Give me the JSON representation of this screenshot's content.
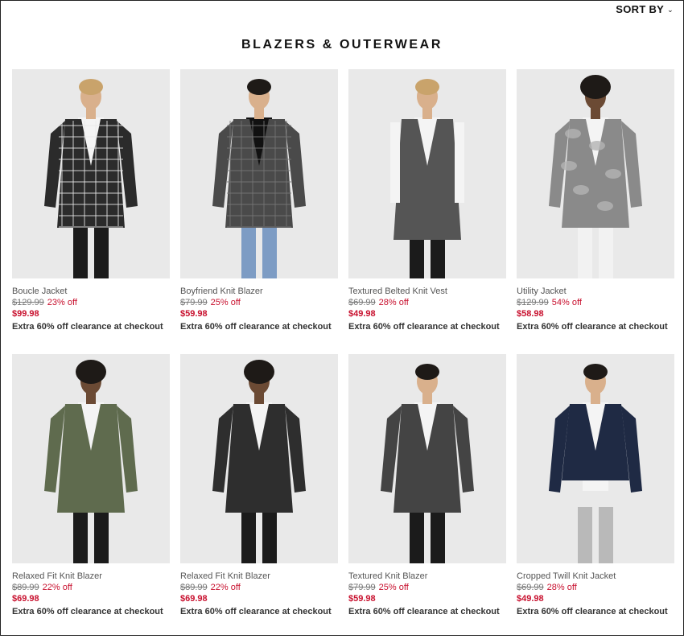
{
  "header": {
    "sort_label": "SORT BY",
    "title": "BLAZERS & OUTERWEAR"
  },
  "products": [
    {
      "name": "Boucle Jacket",
      "original_price": "$129.99",
      "discount": "23% off",
      "sale_price": "$99.98",
      "promo": "Extra 60% off clearance at checkout",
      "color": "#2b2b2b",
      "pattern": "plaid"
    },
    {
      "name": "Boyfriend Knit Blazer",
      "original_price": "$79.99",
      "discount": "25% off",
      "sale_price": "$59.98",
      "promo": "Extra 60% off clearance at checkout",
      "color": "#4a4a4a",
      "pattern": "check"
    },
    {
      "name": "Textured Belted Knit Vest",
      "original_price": "$69.99",
      "discount": "28% off",
      "sale_price": "$49.98",
      "promo": "Extra 60% off clearance at checkout",
      "color": "#555555",
      "pattern": "vest"
    },
    {
      "name": "Utility Jacket",
      "original_price": "$129.99",
      "discount": "54% off",
      "sale_price": "$58.98",
      "promo": "Extra 60% off clearance at checkout",
      "color": "#8a8a8a",
      "pattern": "camo"
    },
    {
      "name": "Relaxed Fit Knit Blazer",
      "original_price": "$89.99",
      "discount": "22% off",
      "sale_price": "$69.98",
      "promo": "Extra 60% off clearance at checkout",
      "color": "#5f6b4e",
      "pattern": "solid"
    },
    {
      "name": "Relaxed Fit Knit Blazer",
      "original_price": "$89.99",
      "discount": "22% off",
      "sale_price": "$69.98",
      "promo": "Extra 60% off clearance at checkout",
      "color": "#2e2e2e",
      "pattern": "solid"
    },
    {
      "name": "Textured Knit Blazer",
      "original_price": "$79.99",
      "discount": "25% off",
      "sale_price": "$59.98",
      "promo": "Extra 60% off clearance at checkout",
      "color": "#444444",
      "pattern": "solid"
    },
    {
      "name": "Cropped Twill Knit Jacket",
      "original_price": "$69.99",
      "discount": "28% off",
      "sale_price": "$49.98",
      "promo": "Extra 60% off clearance at checkout",
      "color": "#1f2a44",
      "pattern": "cropped"
    }
  ]
}
